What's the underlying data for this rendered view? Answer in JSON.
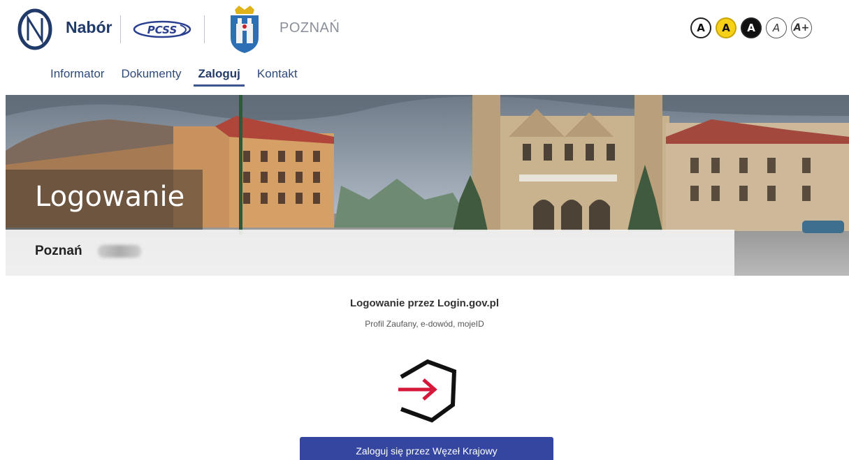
{
  "header": {
    "brand": "Nabór",
    "partner_logo_text": "PCSS",
    "city": "POZNAŃ",
    "accessibility": [
      {
        "label": "A",
        "name": "contrast-normal"
      },
      {
        "label": "A",
        "name": "contrast-yellow"
      },
      {
        "label": "A",
        "name": "contrast-dark"
      },
      {
        "label": "A",
        "name": "font-default"
      },
      {
        "label": "A+",
        "name": "font-larger"
      }
    ]
  },
  "nav": {
    "items": [
      {
        "label": "Informator",
        "active": false
      },
      {
        "label": "Dokumenty",
        "active": false
      },
      {
        "label": "Zaloguj",
        "active": true
      },
      {
        "label": "Kontakt",
        "active": false
      }
    ]
  },
  "hero": {
    "title": "Logowanie",
    "subtitle": "Poznań"
  },
  "login": {
    "title": "Logowanie przez Login.gov.pl",
    "subtitle": "Profil Zaufany, e-dowód, mojeID",
    "button_label": "Zaloguj się przez Węzeł Krajowy"
  },
  "colors": {
    "brand_navy": "#1f3a68",
    "nav_text": "#2f4a7a",
    "button_blue": "#3546a0",
    "login_arrow_red": "#d6173a"
  }
}
